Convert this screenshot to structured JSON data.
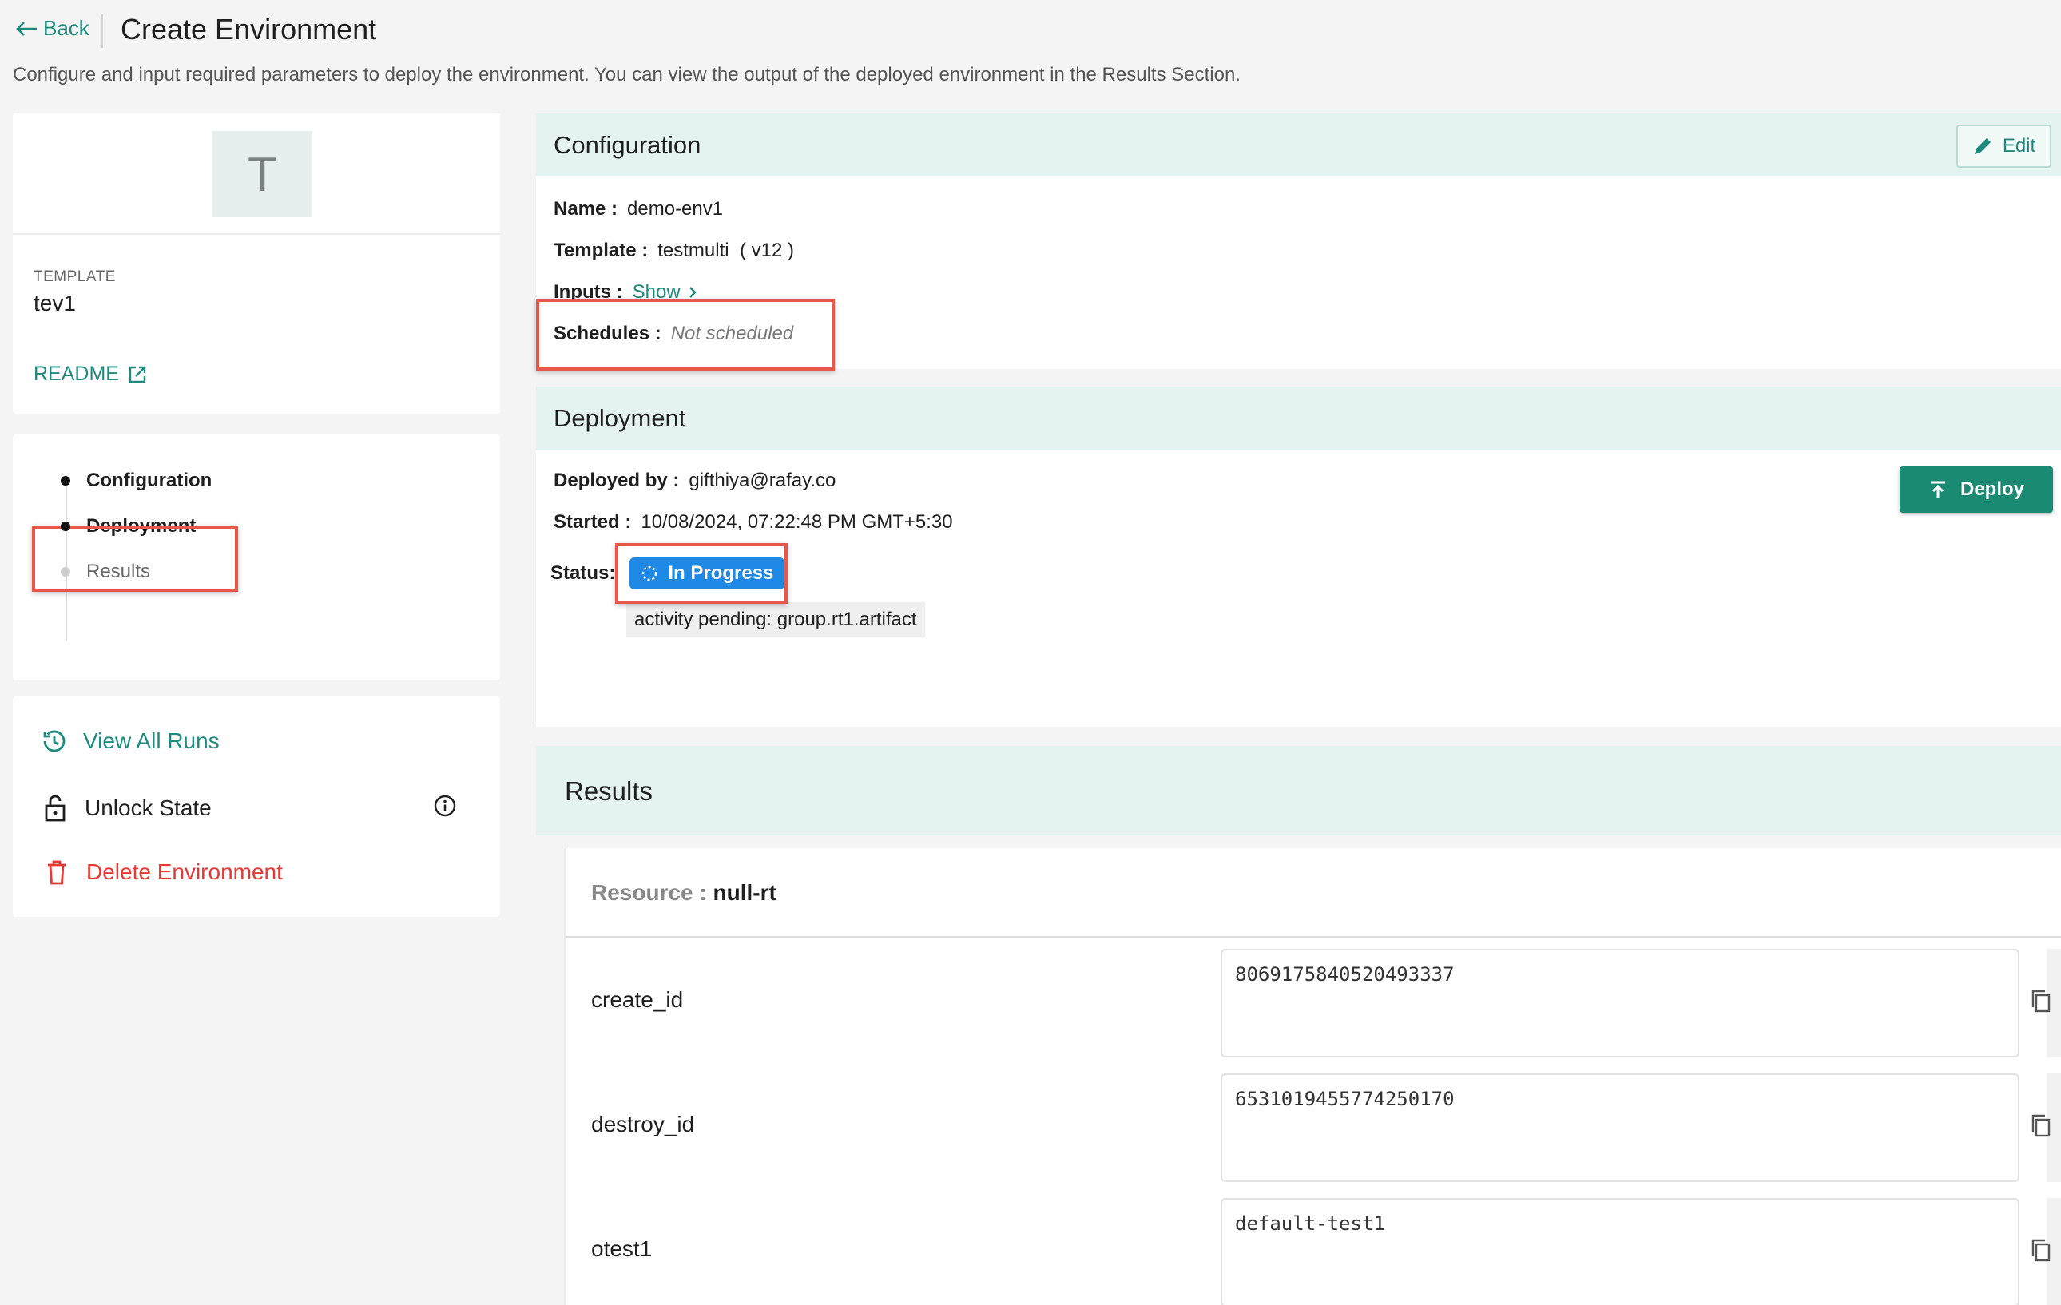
{
  "header": {
    "back_label": "Back",
    "title": "Create Environment",
    "subtitle": "Configure and input required parameters to deploy the environment. You can view the output of the deployed environment in the Results Section."
  },
  "template_card": {
    "avatar_letter": "T",
    "label": "TEMPLATE",
    "value": "tev1",
    "readme_label": "README"
  },
  "steps": [
    {
      "label": "Configuration",
      "state": "done"
    },
    {
      "label": "Deployment",
      "state": "active"
    },
    {
      "label": "Results",
      "state": "pending"
    }
  ],
  "actions": {
    "view_all_runs": "View All Runs",
    "unlock_state": "Unlock State",
    "delete_environment": "Delete Environment"
  },
  "configuration": {
    "title": "Configuration",
    "edit_label": "Edit",
    "name_key": "Name :",
    "name_value": "demo-env1",
    "template_key": "Template :",
    "template_value": "testmulti  ( v12 )",
    "inputs_key": "Inputs :",
    "inputs_link": "Show",
    "schedules_key": "Schedules :",
    "schedules_value": "Not scheduled"
  },
  "deployment": {
    "title": "Deployment",
    "deploy_label": "Deploy",
    "deployed_by_key": "Deployed by :",
    "deployed_by_value": "gifthiya@rafay.co",
    "started_key": "Started :",
    "started_value": "10/08/2024, 07:22:48 PM GMT+5:30",
    "status_key": "Status:",
    "status_value": "In Progress",
    "status_tooltip": "activity pending: group.rt1.artifact"
  },
  "results": {
    "title": "Results",
    "resource_key": "Resource :",
    "resource_value": "null-rt",
    "outputs": [
      {
        "key": "create_id",
        "value": "8069175840520493337"
      },
      {
        "key": "destroy_id",
        "value": "6531019455774250170"
      },
      {
        "key": "otest1",
        "value": "default-test1"
      }
    ]
  },
  "colors": {
    "accent": "#1d8a7d",
    "deploy_button": "#1b8a73",
    "status_badge": "#1e88e5",
    "danger": "#e53935",
    "highlight": "#e8574a",
    "section_header": "#e4f3f0"
  }
}
